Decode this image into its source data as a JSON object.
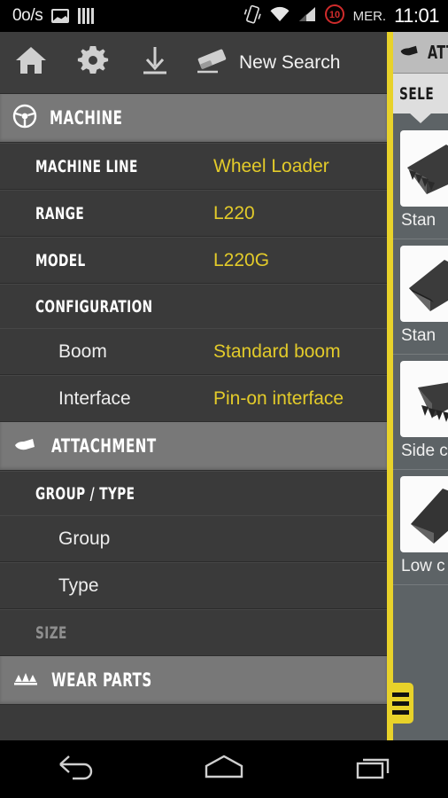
{
  "statusbar": {
    "data_rate": "0o/s",
    "photo_icon": "photo-icon",
    "bars_icon": "barcode-icon",
    "vibrate_icon": "vibrate-icon",
    "wifi_icon": "wifi-icon",
    "signal_icon": "signal-icon",
    "battery_level": "10",
    "day": "MER.",
    "time": "11:01"
  },
  "toolbar": {
    "home_icon": "home-icon",
    "settings_icon": "gear-icon",
    "download_icon": "download-icon",
    "eraser_icon": "eraser-icon",
    "new_search_label": "New Search"
  },
  "sections": {
    "machine": {
      "title": "MACHINE",
      "icon": "steering-wheel-icon",
      "rows": [
        {
          "label": "MACHINE LINE",
          "value": "Wheel Loader"
        },
        {
          "label": "RANGE",
          "value": "L220"
        },
        {
          "label": "MODEL",
          "value": "L220G"
        }
      ],
      "configuration": {
        "label": "CONFIGURATION",
        "rows": [
          {
            "label": "Boom",
            "value": "Standard boom"
          },
          {
            "label": "Interface",
            "value": "Pin-on interface"
          }
        ]
      }
    },
    "attachment": {
      "title": "ATTACHMENT",
      "icon": "bucket-icon",
      "group_type_label": "GROUP / TYPE",
      "rows": [
        {
          "label": "Group",
          "value": ""
        },
        {
          "label": "Type",
          "value": ""
        }
      ],
      "size_label": "SIZE"
    },
    "wear_parts": {
      "title": "WEAR PARTS",
      "icon": "teeth-icon"
    }
  },
  "drawer": {
    "header_title": "ATT",
    "header_icon": "bucket-icon",
    "tab_label": "SELE",
    "handle_icon": "drawer-handle-icon",
    "items": [
      {
        "caption": "Stan",
        "thumb": "bucket-with-teeth-thumb"
      },
      {
        "caption": "Stan",
        "thumb": "standard-bucket-thumb"
      },
      {
        "caption": "Side c\nspade",
        "thumb": "side-cutter-spade-thumb"
      },
      {
        "caption": "Low c",
        "thumb": "low-profile-bucket-thumb"
      }
    ]
  },
  "navbar": {
    "back_icon": "back-icon",
    "home_icon": "home-icon",
    "recents_icon": "recents-icon"
  },
  "colors": {
    "accent_yellow": "#e8d22a",
    "value_yellow": "#e3cb2a",
    "section_gray": "#787878",
    "row_dark": "#3a3a3a",
    "toolbar_dark": "#3d3d3d",
    "drawer_slate": "#5d6366",
    "battery_red": "#cf2b2b"
  }
}
